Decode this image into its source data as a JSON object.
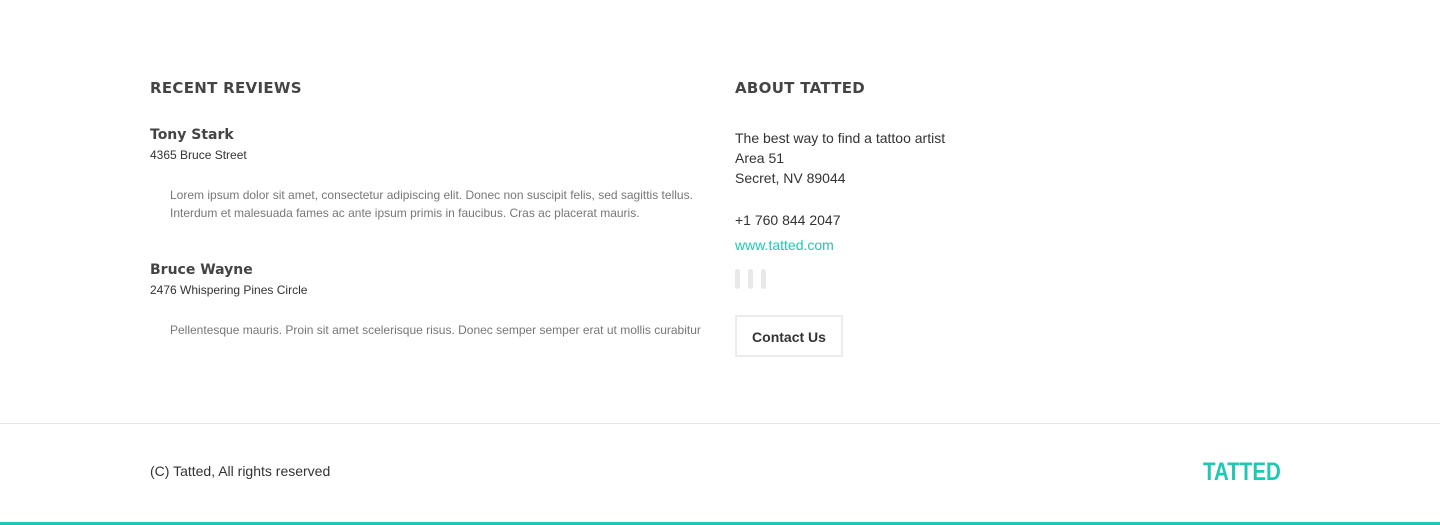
{
  "reviews": {
    "title": "RECENT REVIEWS",
    "items": [
      {
        "name": "Tony Stark",
        "address": "4365 Bruce Street",
        "text": "Lorem ipsum dolor sit amet, consectetur adipiscing elit. Donec non suscipit felis, sed sagittis tellus. Interdum et malesuada fames ac ante ipsum primis in faucibus. Cras ac placerat mauris."
      },
      {
        "name": "Bruce Wayne",
        "address": "2476 Whispering Pines Circle",
        "text": "Pellentesque mauris. Proin sit amet scelerisque risus. Donec semper semper erat ut mollis curabitur"
      }
    ]
  },
  "about": {
    "title": "ABOUT TATTED",
    "tagline": "The best way to find a tattoo artist",
    "address_line1": "Area 51",
    "address_line2": "Secret, NV 89044",
    "phone": "+1 760 844 2047",
    "website": "www.tatted.com",
    "social_icons": [
      "social-icon",
      "social-icon",
      "social-icon"
    ],
    "contact_label": "Contact Us"
  },
  "footer": {
    "copyright": "(C) Tatted, All rights reserved",
    "logo": "TATTED"
  },
  "colors": {
    "accent": "#1ec8b4",
    "heading": "#444444",
    "body_text": "#333333",
    "muted_text": "#777777",
    "divider": "#e6e6e6"
  }
}
